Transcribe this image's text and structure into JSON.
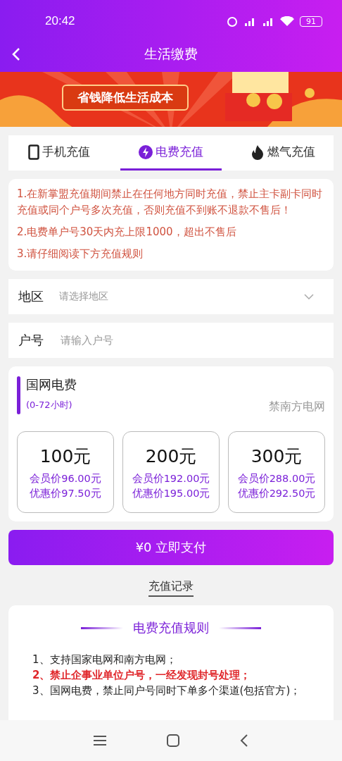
{
  "status_bar": {
    "time": "20:42",
    "battery": "91"
  },
  "header": {
    "title": "生活缴费"
  },
  "banner": {
    "slogan": "省钱降低生活成本"
  },
  "tabs": [
    {
      "label": "手机充值",
      "kind": "phone",
      "selected": false
    },
    {
      "label": "电费充值",
      "kind": "bolt",
      "selected": true
    },
    {
      "label": "燃气充值",
      "kind": "flame",
      "selected": false
    }
  ],
  "notices": [
    "1.在新掌盟充值期间禁止在任何地方同时充值，禁止主卡副卡同时充值或同个户号多次充值，否则充值不到账不退款不售后！",
    "2.电费单户号30天内充上限1000，超出不售后",
    "3.请仔细阅读下方充值规则"
  ],
  "form": [
    {
      "label": "地区",
      "placeholder": "请选择地区",
      "kind": "select"
    },
    {
      "label": "户号",
      "placeholder": "请输入户号",
      "kind": "input"
    }
  ],
  "product": {
    "title": "国网电费",
    "subtitle": "(0-72小时)",
    "note": "禁南方电网",
    "options": [
      {
        "amount": "100元",
        "member_price": "会员价96.00元",
        "discount_price": "优惠价97.50元",
        "selected": false
      },
      {
        "amount": "200元",
        "member_price": "会员价192.00元",
        "discount_price": "优惠价195.00元",
        "selected": false
      },
      {
        "amount": "300元",
        "member_price": "会员价288.00元",
        "discount_price": "优惠价292.50元",
        "selected": false
      }
    ]
  },
  "pay_button": "¥0 立即支付",
  "records_link": "充值记录",
  "rules": {
    "title": "电费充值规则",
    "items": [
      {
        "text": "1、支持国家电网和南方电网；",
        "highlight": false
      },
      {
        "text": "2、禁止企事业单位户号，一经发现封号处理；",
        "highlight": true
      },
      {
        "text": "3、国网电费，禁止同户号同时下单多个渠道(包括官方)；",
        "highlight": false
      }
    ]
  }
}
